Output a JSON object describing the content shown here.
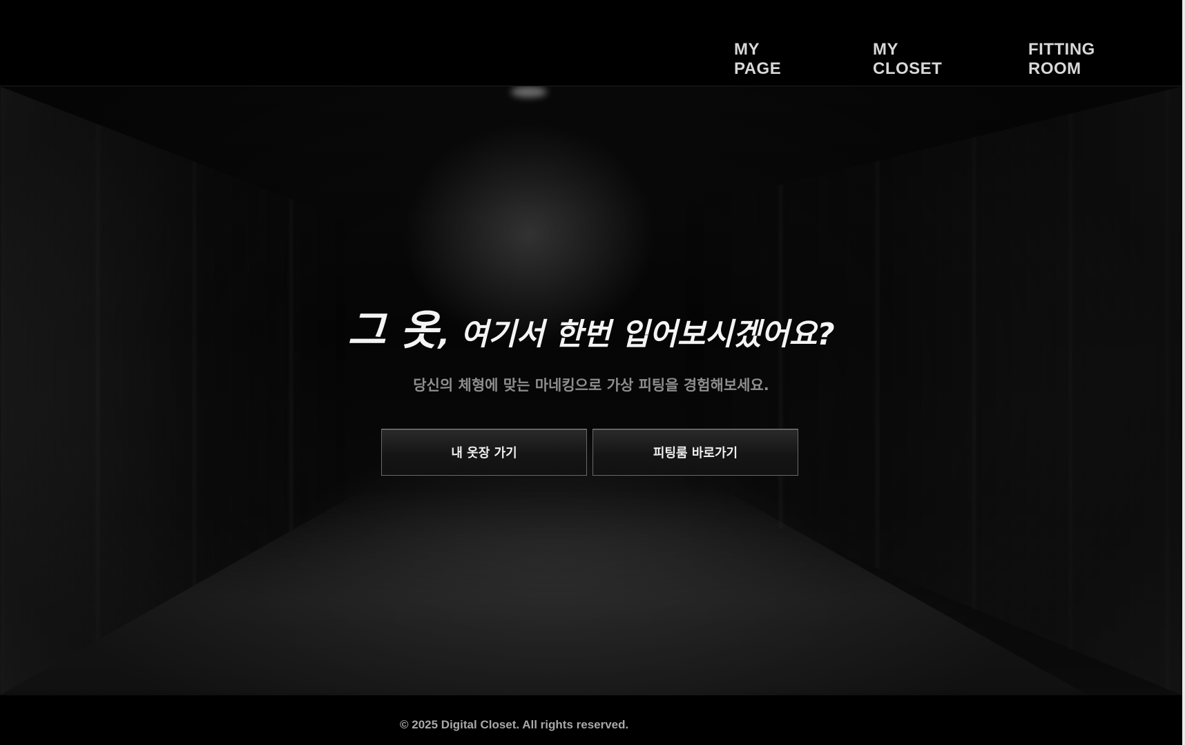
{
  "nav": {
    "items": [
      {
        "label": "MY PAGE"
      },
      {
        "label": "MY CLOSET"
      },
      {
        "label": "FITTING ROOM"
      }
    ]
  },
  "hero": {
    "headline_emphasis": "그 옷",
    "headline_rest": ", 여기서 한번 입어보시겠어요?",
    "subtitle": "당신의 체형에 맞는 마네킹으로 가상 피팅을 경험해보세요.",
    "buttons": [
      {
        "label": "내 옷장 가기"
      },
      {
        "label": "피팅룸 바로가기"
      }
    ]
  },
  "footer": {
    "copyright": "© 2025 Digital Closet. All rights reserved."
  },
  "colors": {
    "background": "#000000",
    "text_primary": "#f4f4f4",
    "text_secondary": "#8e8e8e",
    "button_border": "#6a6a6a"
  }
}
